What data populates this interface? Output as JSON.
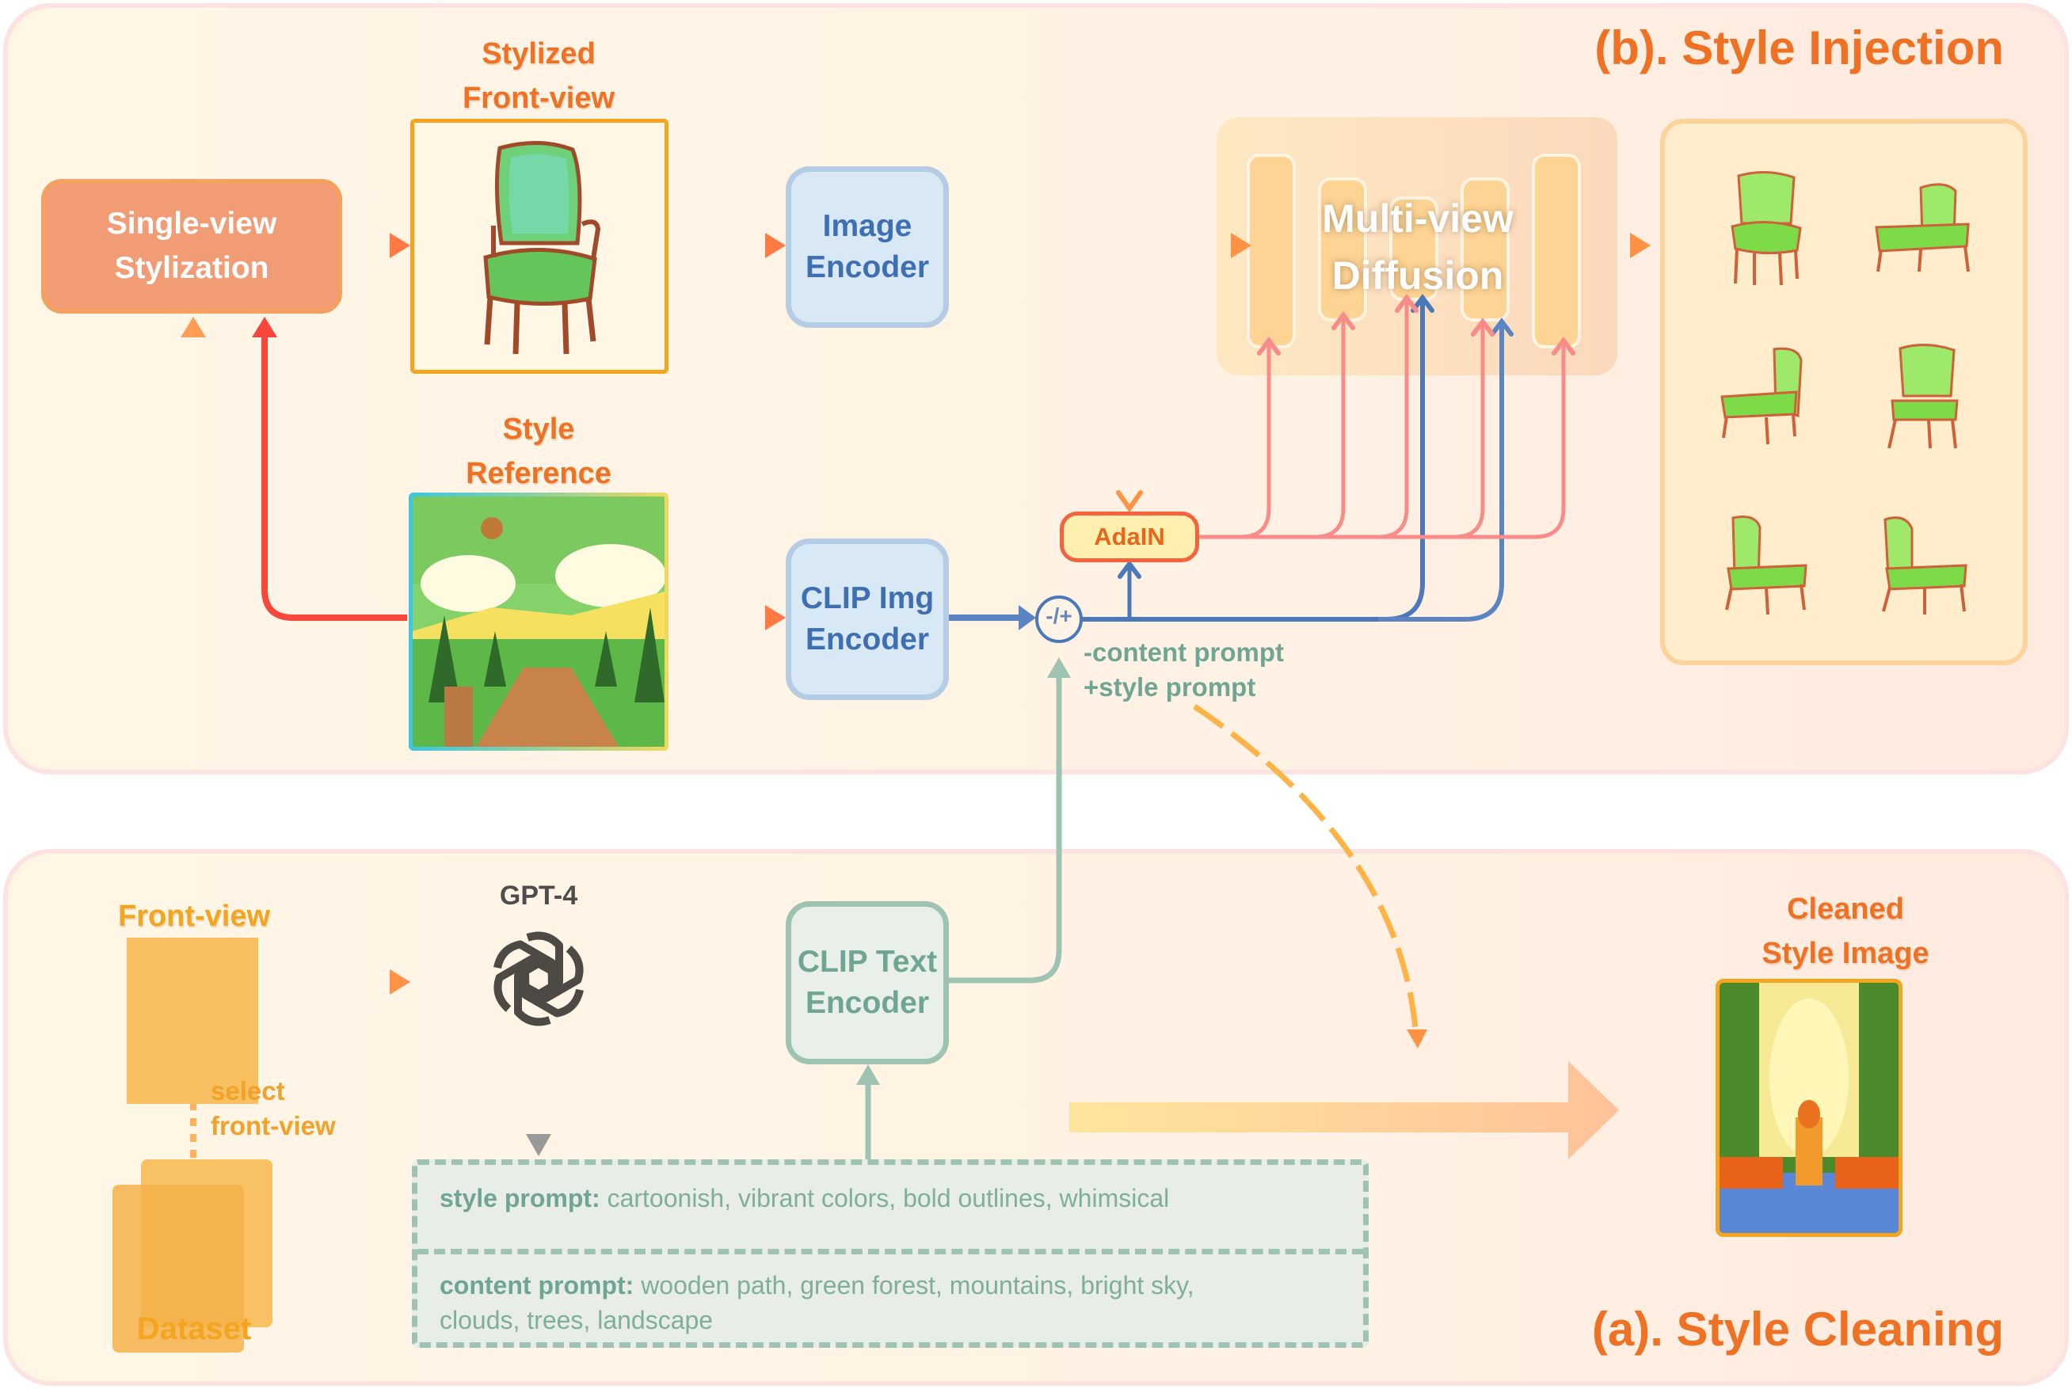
{
  "panels": {
    "style_injection": {
      "title": "(b). Style Injection"
    },
    "style_cleaning": {
      "title": "(a). Style Cleaning"
    }
  },
  "nodes": {
    "single_view_stylization": {
      "line1": "Single-view",
      "line2": "Stylization"
    },
    "stylized_front_view": {
      "line1": "Stylized",
      "line2": "Front-view"
    },
    "style_reference": {
      "line1": "Style",
      "line2": "Reference"
    },
    "image_encoder": {
      "line1": "Image",
      "line2": "Encoder"
    },
    "clip_img_encoder": {
      "line1": "CLIP Img",
      "line2": "Encoder"
    },
    "multiview_diffusion": {
      "line1": "Multi-view",
      "line2": "Diffusion"
    },
    "adain": {
      "label": "AdaIN"
    },
    "combine_op": {
      "label": "-/+"
    },
    "combine_note": {
      "line1": "-content prompt",
      "line2": "+style prompt"
    },
    "front_view": {
      "label": "Front-view"
    },
    "select_note": {
      "line1": "select",
      "line2": "front-view"
    },
    "dataset": {
      "label": "Dataset"
    },
    "gpt4": {
      "label": "GPT-4",
      "icon": "openai-logo-icon"
    },
    "clip_text_encoder": {
      "line1": "CLIP Text",
      "line2": "Encoder"
    },
    "cleaned_style_image": {
      "line1": "Cleaned",
      "line2": "Style Image"
    }
  },
  "prompts": {
    "style": {
      "key": "style prompt:",
      "value": "cartoonish, vibrant colors, bold outlines, whimsical"
    },
    "content": {
      "key": "content prompt:",
      "value": "wooden path, green forest, mountains, bright sky,",
      "value2": "clouds, trees, landscape"
    }
  },
  "outputs": {
    "multiview_chairs": [
      "front",
      "side-right",
      "back-left",
      "front-left",
      "side-back",
      "rear"
    ]
  },
  "colors": {
    "accent_orange": "#ee7124",
    "red_arrow": "#f7473a",
    "blue_arrow": "#4b78b8",
    "pink_arrow": "#f98b89",
    "green_arrow": "#9ec3b3",
    "yellow_arrow": "#ffd84d"
  }
}
